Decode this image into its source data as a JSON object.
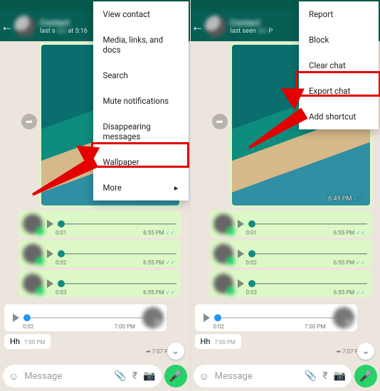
{
  "colors": {
    "header": "#075e54",
    "accent": "#25d366",
    "ticks": "#4fc3f7",
    "highlight": "#e20000"
  },
  "left": {
    "status_time": "5:16",
    "contact_name": "Contact",
    "last_seen_prefix": "last s",
    "last_seen_time": "at 5:16",
    "menu": {
      "items": [
        {
          "label": "View contact"
        },
        {
          "label": "Media, links, and docs"
        },
        {
          "label": "Search"
        },
        {
          "label": "Mute notifications"
        },
        {
          "label": "Disappearing messages"
        },
        {
          "label": "Wallpaper"
        },
        {
          "label": "More",
          "chevron": "▸",
          "highlight": true
        }
      ]
    },
    "image_time": "6:49 PM",
    "voice": [
      {
        "dur": "0:01",
        "time": "6:55 PM"
      },
      {
        "dur": "0:02",
        "time": "6:55 PM"
      },
      {
        "dur": "0:03",
        "time": "6:55 PM"
      }
    ],
    "voice_in": {
      "dur": "0:02",
      "time": "7:00 PM"
    },
    "hh": {
      "text": "Hh",
      "time": "7:00 PM"
    },
    "sent_time": "7:07 PM",
    "input_placeholder": "Message"
  },
  "right": {
    "contact_name": "Contact",
    "last_seen_prefix": "last seen",
    "last_seen_time": "P",
    "menu": {
      "items": [
        {
          "label": "Report"
        },
        {
          "label": "Block"
        },
        {
          "label": "Clear chat"
        },
        {
          "label": "Export chat",
          "highlight": true
        },
        {
          "label": "Add shortcut"
        }
      ]
    },
    "image_time": "6:49 PM",
    "voice": [
      {
        "dur": "0:01",
        "time": "6:55 PM"
      },
      {
        "dur": "0:02",
        "time": "6:55 PM"
      },
      {
        "dur": "0:03",
        "time": "6:55 PM"
      }
    ],
    "voice_in": {
      "dur": "0:02",
      "time": "7:00 PM"
    },
    "hh": {
      "text": "Hh",
      "time": "7:00 PM"
    },
    "sent_time": "7:07 PM",
    "input_placeholder": "Message"
  }
}
